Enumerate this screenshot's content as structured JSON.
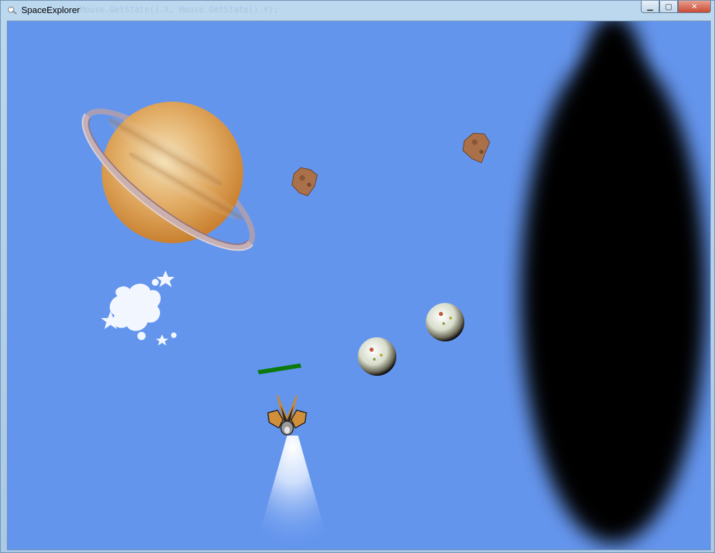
{
  "window": {
    "title": "SpaceExplorer",
    "background_code_text": "(Mouse.GetState().X, Mouse.GetState().Y);",
    "controls": {
      "minimize": "▁",
      "maximize": "▢",
      "close": "✕"
    }
  },
  "game": {
    "background_color": "#6495ed",
    "health_bar_color": "#0b7a0b",
    "sprites": [
      "saturn-planet-sprite",
      "asteroid-sprite",
      "asteroid-sprite",
      "star-splash-sprite",
      "moon-orb-sprite",
      "moon-orb-sprite",
      "player-spaceship-sprite",
      "engine-thrust-sprite",
      "black-hole-sprite"
    ]
  }
}
